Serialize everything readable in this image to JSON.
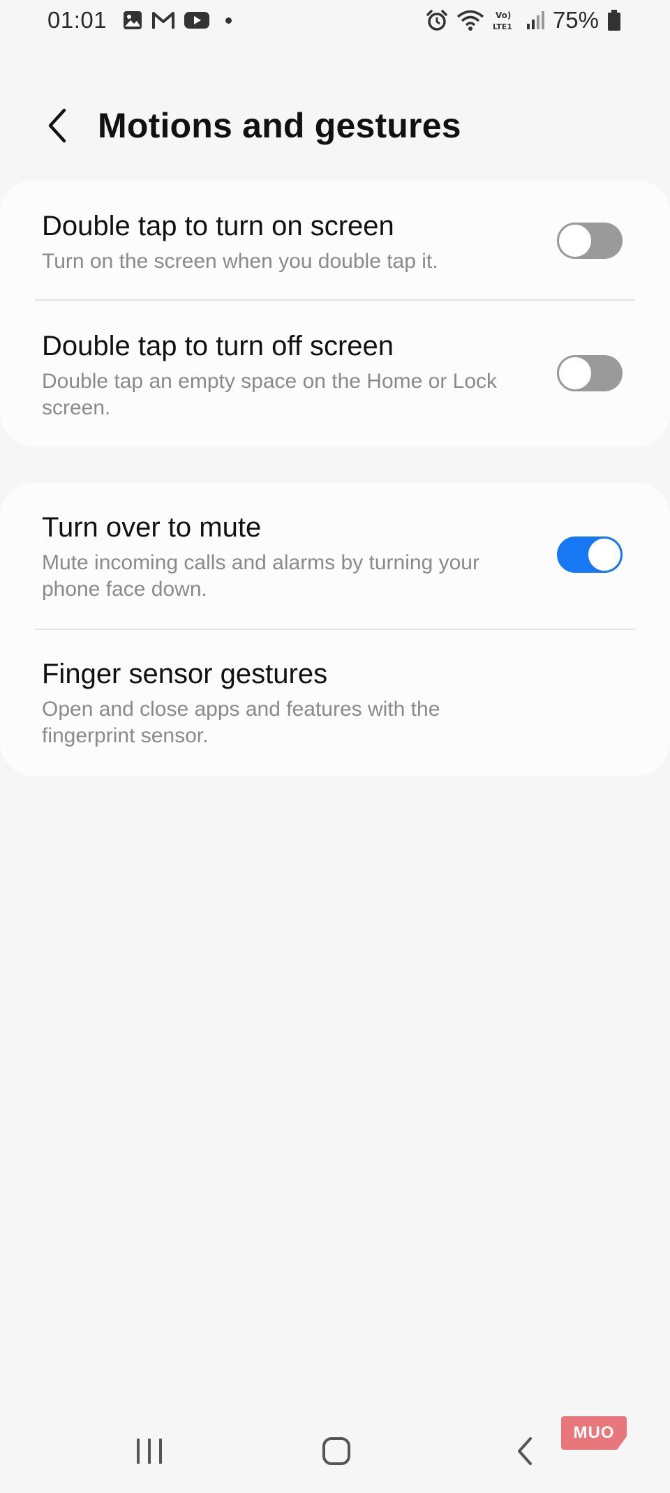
{
  "status_bar": {
    "time": "01:01",
    "battery_percent": "75%",
    "left_icons": [
      "gallery-icon",
      "gmail-icon",
      "youtube-icon",
      "notification-dot"
    ],
    "right_icons": [
      "alarm-icon",
      "wifi-icon",
      "volte-icon",
      "signal-icon",
      "battery-icon"
    ]
  },
  "header": {
    "title": "Motions and gestures",
    "back_icon": "chevron-left-icon"
  },
  "groups": [
    {
      "items": [
        {
          "title": "Double tap to turn on screen",
          "subtitle": "Turn on the screen when you double tap it.",
          "toggle": false
        },
        {
          "title": "Double tap to turn off screen",
          "subtitle": "Double tap an empty space on the Home or Lock screen.",
          "toggle": false
        }
      ]
    },
    {
      "items": [
        {
          "title": "Turn over to mute",
          "subtitle": "Mute incoming calls and alarms by turning your phone face down.",
          "toggle": true
        },
        {
          "title": "Finger sensor gestures",
          "subtitle": "Open and close apps and features with the fingerprint sensor."
        }
      ]
    }
  ],
  "nav_bar": {
    "icons": [
      "recents-icon",
      "home-icon",
      "back-icon"
    ]
  },
  "watermark": {
    "text": "MUO"
  },
  "colors": {
    "background": "#f6f6f6",
    "card": "#fcfcfc",
    "accent": "#1678f2",
    "toggle_off": "#9a9a9a",
    "subtitle": "#8a8a8a"
  }
}
